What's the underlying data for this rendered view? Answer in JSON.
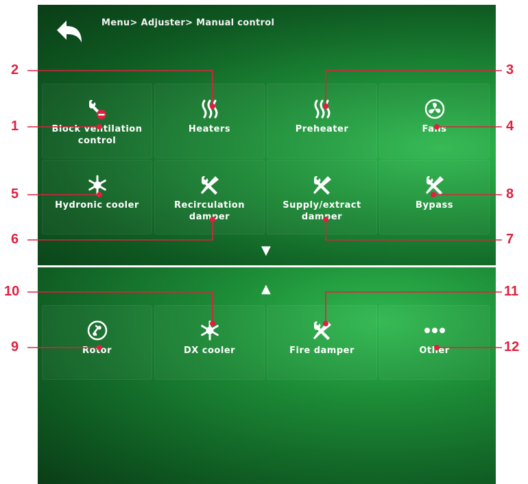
{
  "header": {
    "breadcrumb": "Menu> Adjuster> Manual control"
  },
  "page1": {
    "tiles": [
      {
        "label": "Block ventilation\ncontrol",
        "icon": "wrench-block-icon"
      },
      {
        "label": "Heaters",
        "icon": "heater-icon"
      },
      {
        "label": "Preheater",
        "icon": "heater-icon"
      },
      {
        "label": "Fans",
        "icon": "fan-icon"
      },
      {
        "label": "Hydronic cooler",
        "icon": "snowflake-icon"
      },
      {
        "label": "Recirculation\ndamper",
        "icon": "tools-icon"
      },
      {
        "label": "Supply/extract\ndamper",
        "icon": "tools-icon"
      },
      {
        "label": "Bypass",
        "icon": "tools-icon"
      }
    ],
    "down_arrow": "▼"
  },
  "page2": {
    "up_arrow": "▲",
    "tiles": [
      {
        "label": "Rotor",
        "icon": "rotor-icon"
      },
      {
        "label": "DX cooler",
        "icon": "snowflake-icon"
      },
      {
        "label": "Fire damper",
        "icon": "tools-icon"
      },
      {
        "label": "Other",
        "icon": "dots-icon"
      }
    ]
  },
  "callouts": [
    "1",
    "2",
    "3",
    "4",
    "5",
    "6",
    "7",
    "8",
    "9",
    "10",
    "11",
    "12"
  ],
  "colors": {
    "callout": "#e0203f",
    "background": "#1c8a36",
    "text": "#ffffff"
  }
}
